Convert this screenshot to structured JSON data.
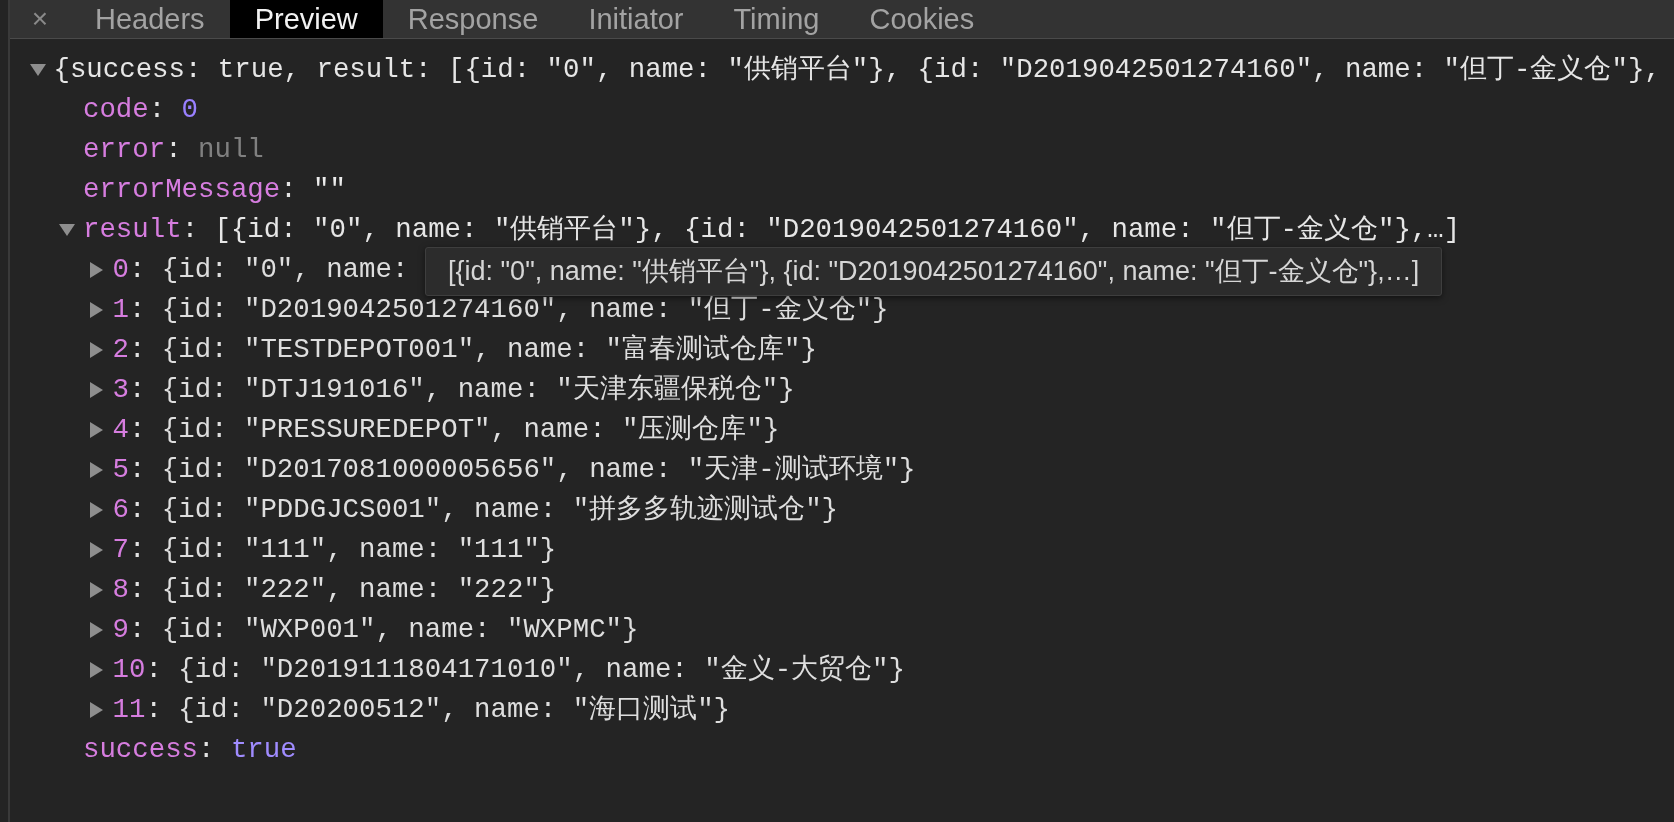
{
  "tabs_bar": {
    "close_button": "×",
    "tabs": [
      {
        "label": "Headers",
        "selected": false
      },
      {
        "label": "Preview",
        "selected": true
      },
      {
        "label": "Response",
        "selected": false
      },
      {
        "label": "Initiator",
        "selected": false
      },
      {
        "label": "Timing",
        "selected": false
      },
      {
        "label": "Cookies",
        "selected": false
      }
    ]
  },
  "tree": {
    "summary": "{success: true, result: [{id: \"0\", name: \"供销平台\"}, {id: \"D2019042501274160\", name: \"但丁-金义仓\"},",
    "expanded": true,
    "properties": [
      {
        "key": "code",
        "separator": ":",
        "value": "0",
        "kind": "number"
      },
      {
        "key": "error",
        "separator": ":",
        "value": "null",
        "kind": "null"
      },
      {
        "key": "errorMessage",
        "separator": ":",
        "value": "\"\"",
        "kind": "string"
      },
      {
        "key": "result",
        "separator": ":",
        "value": "[{id: \"0\", name: \"供销平台\"}, {id: \"D2019042501274160\", name: \"但丁-金义仓\"},…]",
        "kind": "preview",
        "expanded": true,
        "children": [
          {
            "key": "0",
            "separator": ":",
            "value": "{id: \"0\", name:",
            "kind": "object",
            "expanded": false
          },
          {
            "key": "1",
            "separator": ":",
            "value": "{id: \"D2019042501274160\", name: \"但丁-金义仓\"}",
            "kind": "object",
            "expanded": false
          },
          {
            "key": "2",
            "separator": ":",
            "value": "{id: \"TESTDEPOT001\", name: \"富春测试仓库\"}",
            "kind": "object",
            "expanded": false
          },
          {
            "key": "3",
            "separator": ":",
            "value": "{id: \"DTJ191016\", name: \"天津东疆保税仓\"}",
            "kind": "object",
            "expanded": false
          },
          {
            "key": "4",
            "separator": ":",
            "value": "{id: \"PRESSUREDEPOT\", name: \"压测仓库\"}",
            "kind": "object",
            "expanded": false
          },
          {
            "key": "5",
            "separator": ":",
            "value": "{id: \"D2017081000005656\", name: \"天津-测试环境\"}",
            "kind": "object",
            "expanded": false
          },
          {
            "key": "6",
            "separator": ":",
            "value": "{id: \"PDDGJCS001\", name: \"拼多多轨迹测试仓\"}",
            "kind": "object",
            "expanded": false
          },
          {
            "key": "7",
            "separator": ":",
            "value": "{id: \"111\", name: \"111\"}",
            "kind": "object",
            "expanded": false
          },
          {
            "key": "8",
            "separator": ":",
            "value": "{id: \"222\", name: \"222\"}",
            "kind": "object",
            "expanded": false
          },
          {
            "key": "9",
            "separator": ":",
            "value": "{id: \"WXP001\", name: \"WXPMC\"}",
            "kind": "object",
            "expanded": false
          },
          {
            "key": "10",
            "separator": ":",
            "value": "{id: \"D2019111804171010\", name: \"金义-大贸仓\"}",
            "kind": "object",
            "expanded": false
          },
          {
            "key": "11",
            "separator": ":",
            "value": "{id: \"D20200512\", name: \"海口测试\"}",
            "kind": "object",
            "expanded": false
          }
        ]
      },
      {
        "key": "success",
        "separator": ":",
        "value": "true",
        "kind": "boolean"
      }
    ]
  },
  "tooltip": {
    "text": "[{id: \"0\", name: \"供销平台\"}, {id: \"D2019042501274160\", name: \"但丁-金义仓\"},…]"
  }
}
